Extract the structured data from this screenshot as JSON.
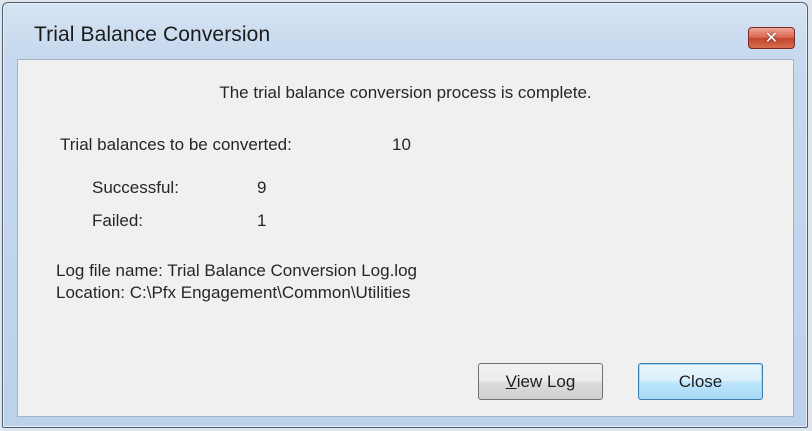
{
  "window": {
    "title": "Trial Balance Conversion",
    "close_glyph": "✕"
  },
  "dialog": {
    "message": "The trial balance conversion process is complete.",
    "stats": {
      "total_label": "Trial balances to be converted:",
      "total_value": "10",
      "successful_label": "Successful:",
      "successful_value": "9",
      "failed_label": "Failed:",
      "failed_value": "1"
    },
    "log": {
      "file_name_line": "Log file name: Trial Balance Conversion Log.log",
      "location_line": "Location: C:\\Pfx Engagement\\Common\\Utilities"
    }
  },
  "buttons": {
    "view_log_mnemonic": "V",
    "view_log_rest": "iew Log",
    "close_label": "Close"
  },
  "icons": {
    "close": "close-icon"
  },
  "colors": {
    "titlebar": "#c7d9ee",
    "close_button": "#c1452c",
    "client_bg": "#f0f0f0",
    "default_button_border": "#3c7fb1"
  }
}
